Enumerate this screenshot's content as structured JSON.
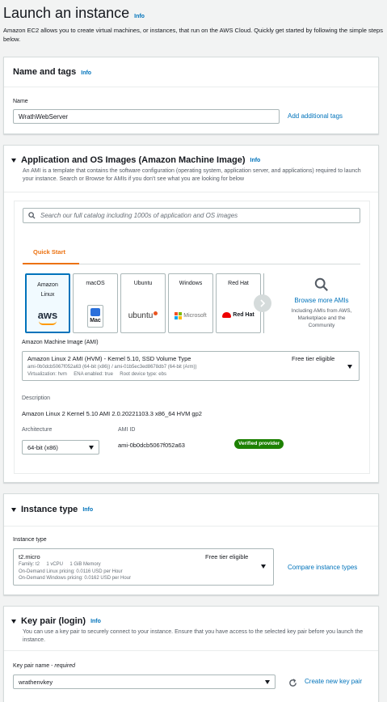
{
  "header": {
    "title": "Launch an instance",
    "info": "Info",
    "description": "Amazon EC2 allows you to create virtual machines, or instances, that run on the AWS Cloud. Quickly get started by following the simple steps below."
  },
  "name_tags": {
    "title": "Name and tags",
    "info": "Info",
    "name_label": "Name",
    "name_value": "WrathWebServer",
    "add_tags": "Add additional tags"
  },
  "ami": {
    "title": "Application and OS Images (Amazon Machine Image)",
    "info": "Info",
    "description": "An AMI is a template that contains the software configuration (operating system, application server, and applications) required to launch your instance. Search or Browse for AMIs if you don't see what you are looking for below",
    "search_placeholder": "Search our full catalog including 1000s of application and OS images",
    "tab_quick_start": "Quick Start",
    "os_tiles": [
      {
        "name": "Amazon Linux",
        "logo": "aws"
      },
      {
        "name": "macOS",
        "logo": "Mac"
      },
      {
        "name": "Ubuntu",
        "logo": "ubuntu"
      },
      {
        "name": "Windows",
        "logo": "Microsoft"
      },
      {
        "name": "Red Hat",
        "logo": "Red Hat"
      }
    ],
    "browse_more": "Browse more AMIs",
    "browse_sub": "Including AMIs from AWS, Marketplace and the Community",
    "ami_label": "Amazon Machine Image (AMI)",
    "ami_name": "Amazon Linux 2 AMI (HVM) - Kernel 5.10, SSD Volume Type",
    "ami_ids": "ami-0b0dcb5067f052a63 (64-bit (x86)) / ami-01b5ec3ed8678db7 (64-bit (Arm))",
    "ami_meta": "Virtualization: hvm     ENA enabled: true     Root device type: ebs",
    "free_tier": "Free tier eligible",
    "description_label": "Description",
    "description_value": "Amazon Linux 2 Kernel 5.10 AMI 2.0.20221103.3 x86_64 HVM gp2",
    "architecture_label": "Architecture",
    "architecture_value": "64-bit (x86)",
    "ami_id_label": "AMI ID",
    "ami_id_value": "ami-0b0dcb5067f052a63",
    "verified": "Verified provider"
  },
  "instance_type": {
    "title": "Instance type",
    "info": "Info",
    "label": "Instance type",
    "value": "t2.micro",
    "free_tier": "Free tier eligible",
    "specs": "Family: t2     1 vCPU     1 GiB Memory",
    "pricing_linux": "On-Demand Linux pricing: 0.0116 USD per Hour",
    "pricing_windows": "On-Demand Windows pricing: 0.0162 USD per Hour",
    "compare": "Compare instance types"
  },
  "key_pair": {
    "title": "Key pair (login)",
    "info": "Info",
    "description": "You can use a key pair to securely connect to your instance. Ensure that you have access to the selected key pair before you launch the instance.",
    "name_label": "Key pair name - ",
    "required": "required",
    "value": "wrathenvkey",
    "create": "Create new key pair"
  },
  "colors": {
    "accent": "#0073bb",
    "tab_active": "#ec7211",
    "verified_bg": "#1d8102",
    "aws_orange": "#ff9900"
  }
}
